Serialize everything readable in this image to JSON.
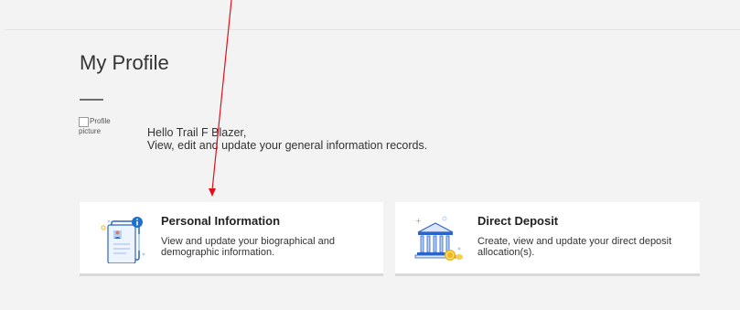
{
  "page": {
    "title": "My Profile"
  },
  "profile": {
    "avatar_alt": "Profile picture",
    "greeting": "Hello Trail F Blazer,",
    "subtitle": "View, edit and update your general information records."
  },
  "cards": [
    {
      "title": "Personal Information",
      "description": "View and update your biographical and demographic information.",
      "icon": "id-card-icon"
    },
    {
      "title": "Direct Deposit",
      "description": "Create, view and update your direct deposit allocation(s).",
      "icon": "bank-icon"
    }
  ],
  "colors": {
    "accent_blue": "#1f6fd1",
    "gold": "#f2b817",
    "annotation_red": "#e0101a"
  }
}
